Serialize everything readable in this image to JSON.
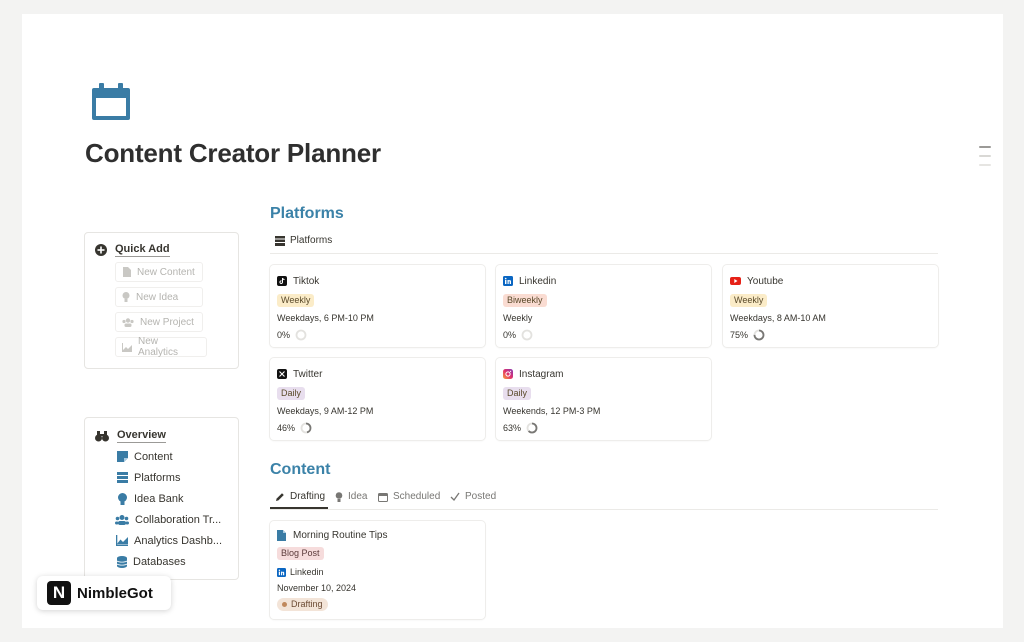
{
  "page": {
    "title": "Content Creator Planner",
    "icon": "calendar-icon",
    "accent": "#3b82a8"
  },
  "quick_add": {
    "title": "Quick Add",
    "items": [
      {
        "label": "New Content",
        "icon": "document-icon"
      },
      {
        "label": "New Idea",
        "icon": "lightbulb-icon"
      },
      {
        "label": "New Project",
        "icon": "people-icon"
      },
      {
        "label": "New Analytics",
        "icon": "chart-icon"
      }
    ]
  },
  "overview": {
    "title": "Overview",
    "items": [
      {
        "label": "Content",
        "icon": "note-icon"
      },
      {
        "label": "Platforms",
        "icon": "stack-icon"
      },
      {
        "label": "Idea Bank",
        "icon": "lightbulb-icon"
      },
      {
        "label": "Collaboration Tr...",
        "icon": "people-icon"
      },
      {
        "label": "Analytics Dashb...",
        "icon": "chart-icon"
      },
      {
        "label": "Databases",
        "icon": "database-icon"
      }
    ]
  },
  "platforms": {
    "section_title": "Platforms",
    "view_label": "Platforms",
    "cards": [
      {
        "name": "Tiktok",
        "icon": "tiktok-icon",
        "frequency": "Weekly",
        "tag_color": "#fbecc8",
        "schedule": "Weekdays, 6 PM-10 PM",
        "progress_label": "0%",
        "progress": 0
      },
      {
        "name": "Linkedin",
        "icon": "linkedin-icon",
        "frequency": "Biweekly",
        "tag_color": "#fadcd2",
        "schedule": "Weekly",
        "progress_label": "0%",
        "progress": 0
      },
      {
        "name": "Youtube",
        "icon": "youtube-icon",
        "frequency": "Weekly",
        "tag_color": "#fbecc8",
        "schedule": "Weekdays, 8 AM-10 AM",
        "progress_label": "75%",
        "progress": 0.75
      },
      {
        "name": "Twitter",
        "icon": "x-icon",
        "frequency": "Daily",
        "tag_color": "#e8deee",
        "schedule": "Weekdays, 9 AM-12 PM",
        "progress_label": "46%",
        "progress": 0.46
      },
      {
        "name": "Instagram",
        "icon": "instagram-icon",
        "frequency": "Daily",
        "tag_color": "#e8deee",
        "schedule": "Weekends, 12 PM-3 PM",
        "progress_label": "63%",
        "progress": 0.63
      }
    ]
  },
  "content": {
    "section_title": "Content",
    "tabs": [
      {
        "label": "Drafting",
        "icon": "pencil-icon",
        "active": true
      },
      {
        "label": "Idea",
        "icon": "lightbulb-icon",
        "active": false
      },
      {
        "label": "Scheduled",
        "icon": "calendar-icon",
        "active": false
      },
      {
        "label": "Posted",
        "icon": "check-icon",
        "active": false
      }
    ],
    "cards": [
      {
        "title": "Morning Routine Tips",
        "type": "Blog Post",
        "platform": "Linkedin",
        "date": "November 10, 2024",
        "status": "Drafting"
      }
    ]
  },
  "brand": {
    "logo_letter": "N",
    "name": "NimbleGot"
  }
}
